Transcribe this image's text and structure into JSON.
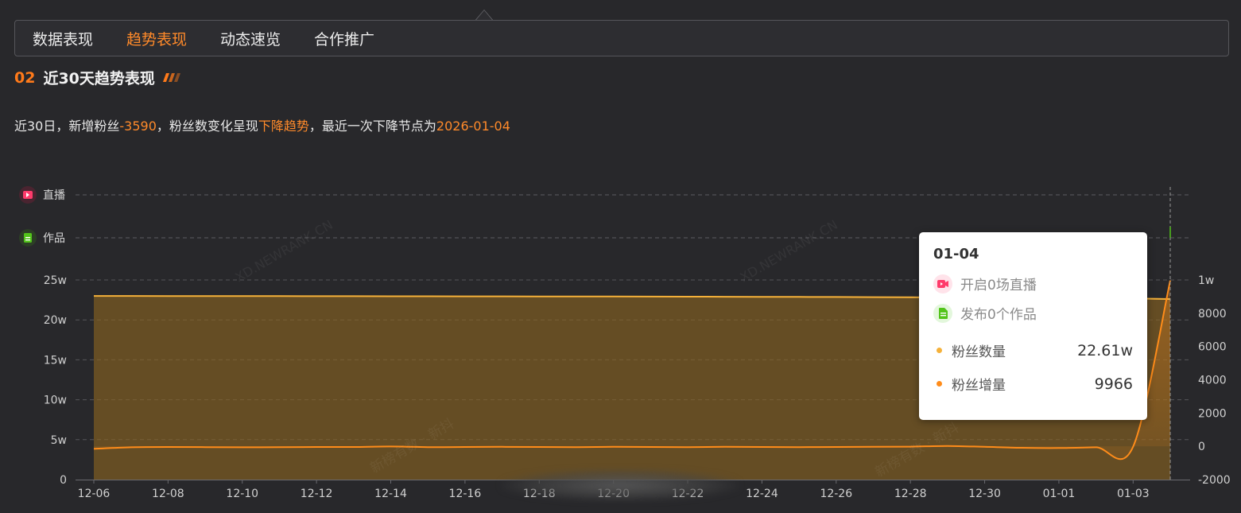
{
  "tabs": [
    {
      "label": "数据表现",
      "active": false
    },
    {
      "label": "趋势表现",
      "active": true
    },
    {
      "label": "动态速览",
      "active": false
    },
    {
      "label": "合作推广",
      "active": false
    }
  ],
  "section": {
    "number": "02",
    "title": "近30天趋势表现"
  },
  "summary": {
    "prefix": "近30日，新增粉丝",
    "gain": "-3590",
    "middle": "，粉丝数变化呈现",
    "trend": "下降趋势",
    "suffix": "，最近一次下降节点为",
    "date": "2026-01-04"
  },
  "watermarks": [
    "XD.NEWRANK.CN",
    "XD.NEWRANK.CN",
    "新榜有数 · 新抖",
    "新榜有数 · 新抖"
  ],
  "colors": {
    "accent": "#ff8a2a",
    "fans_line": "#f5b13a",
    "gain_line": "#ff8c1a",
    "live_icon": "#ff3b6b",
    "works_icon": "#52c41a"
  },
  "tooltip": {
    "date": "01-04",
    "live_text": "开启0场直播",
    "works_text": "发布0个作品",
    "fans_label": "粉丝数量",
    "fans_value": "22.61w",
    "gain_label": "粉丝增量",
    "gain_value": "9966"
  },
  "chart_data": {
    "type": "area",
    "x": [
      "12-06",
      "12-07",
      "12-08",
      "12-09",
      "12-10",
      "12-11",
      "12-12",
      "12-13",
      "12-14",
      "12-15",
      "12-16",
      "12-17",
      "12-18",
      "12-19",
      "12-20",
      "12-21",
      "12-22",
      "12-23",
      "12-24",
      "12-25",
      "12-26",
      "12-27",
      "12-28",
      "12-29",
      "12-30",
      "12-31",
      "01-01",
      "01-02",
      "01-03",
      "01-04"
    ],
    "x_ticks": [
      "12-06",
      "12-08",
      "12-10",
      "12-12",
      "12-14",
      "12-16",
      "12-18",
      "12-20",
      "12-22",
      "12-24",
      "12-26",
      "12-28",
      "12-30",
      "01-01",
      "01-03"
    ],
    "event_rows": [
      "直播",
      "作品"
    ],
    "series": [
      {
        "name": "粉丝数量",
        "axis": "left",
        "values": [
          230000,
          229950,
          229900,
          229850,
          229800,
          229750,
          229700,
          229650,
          229600,
          229550,
          229500,
          229450,
          229400,
          229350,
          229300,
          229200,
          229100,
          229000,
          228900,
          228800,
          228700,
          228500,
          228300,
          228100,
          227900,
          227700,
          227400,
          227100,
          226800,
          226100
        ]
      },
      {
        "name": "粉丝增量",
        "axis": "right",
        "values": [
          -150,
          -60,
          -40,
          -50,
          -60,
          -50,
          -40,
          -40,
          -10,
          -50,
          -40,
          -30,
          -40,
          -50,
          -30,
          -40,
          -50,
          -30,
          -40,
          -50,
          -40,
          -30,
          -20,
          20,
          -30,
          -90,
          -100,
          -60,
          -20,
          9966
        ]
      }
    ],
    "yleft": {
      "ticks": [
        "0",
        "5w",
        "10w",
        "15w",
        "20w",
        "25w"
      ],
      "ylim": [
        0,
        250000
      ]
    },
    "yright": {
      "ticks": [
        "-2000",
        "0",
        "2000",
        "4000",
        "6000",
        "8000",
        "1w"
      ],
      "ylim": [
        -2000,
        10000
      ]
    },
    "grid": "horizontal-dashed"
  }
}
